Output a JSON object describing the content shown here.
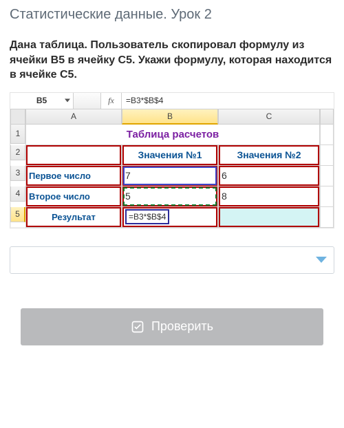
{
  "lesson_title": "Статистические данные. Урок 2",
  "question_html": "Дана таблица. Пользователь скопировал формулу из ячейки B5 в ячейку C5. Укажи формулу, которая находится в ячейке C5.",
  "spreadsheet": {
    "name_box": "B5",
    "fx_label": "fx",
    "formula_bar": "=B3*$B$4",
    "col_headers": [
      "A",
      "B",
      "C"
    ],
    "row_headers": [
      "1",
      "2",
      "3",
      "4",
      "5"
    ],
    "title_row": "Таблица расчетов",
    "header2": {
      "b": "Значения №1",
      "c": "Значения №2"
    },
    "rows": [
      {
        "label": "Первое число",
        "b": "7",
        "c": "6"
      },
      {
        "label": "Второе число",
        "b": "5",
        "c": "8"
      },
      {
        "label": "Результат",
        "b": "=B3*$B$4",
        "c": ""
      }
    ]
  },
  "answer_select_placeholder": "",
  "check_button_label": "Проверить"
}
